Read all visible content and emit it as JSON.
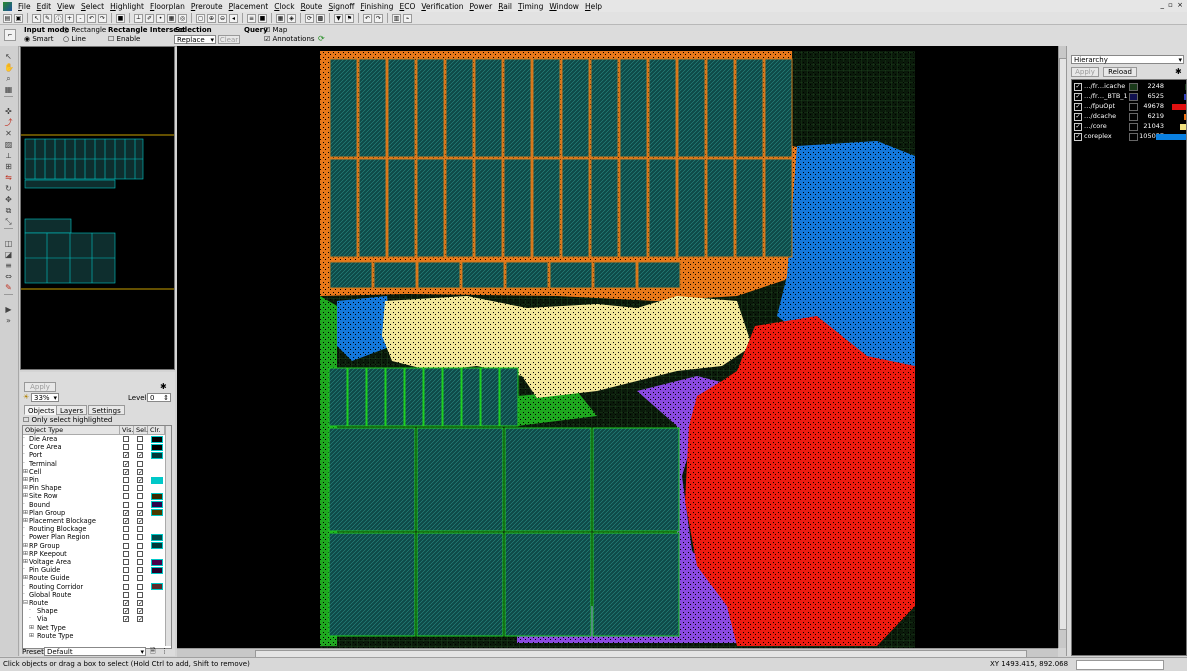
{
  "menubar": {
    "items": [
      "File",
      "Edit",
      "View",
      "Select",
      "Highlight",
      "Floorplan",
      "Preroute",
      "Placement",
      "Clock",
      "Route",
      "Signoff",
      "Finishing",
      "ECO",
      "Verification",
      "Power",
      "Rail",
      "Timing",
      "Window",
      "Help"
    ],
    "window_controls": "_ ▫ ×"
  },
  "options": {
    "input_mode_label": "Input mode",
    "rectangle_label": "Rectangle",
    "smart_label": "Smart",
    "line_label": "Line",
    "rect_intersect_label": "Rectangle Intersect",
    "enable_label": "Enable",
    "selection_label": "Selection",
    "selection_value": "Replace",
    "clear_label": "Clear",
    "query_label": "Query",
    "map_label": "Map",
    "annotations_label": "Annotations"
  },
  "left_panel": {
    "apply_label": "Apply",
    "zoom_value": "33%",
    "level_label": "Level",
    "level_value": "0",
    "tabs": [
      "Objects",
      "Layers",
      "Settings"
    ],
    "only_highlighted_label": "Only select highlighted",
    "columns": [
      "Object Type",
      "Vis.",
      "Sel.",
      "Clr."
    ],
    "rows": [
      {
        "name": "Die Area",
        "vis": false,
        "sel": false,
        "swatch": "#000000",
        "expander": ""
      },
      {
        "name": "Core Area",
        "vis": false,
        "sel": false,
        "swatch": "#000000",
        "expander": ""
      },
      {
        "name": "Port",
        "vis": true,
        "sel": true,
        "swatch": "#003a3a",
        "expander": ""
      },
      {
        "name": "Terminal",
        "vis": true,
        "sel": false,
        "swatch": "",
        "expander": ""
      },
      {
        "name": "Cell",
        "vis": true,
        "sel": true,
        "swatch": "",
        "expander": "+"
      },
      {
        "name": "Pin",
        "vis": false,
        "sel": true,
        "swatch": "#00c8c8",
        "expander": "+"
      },
      {
        "name": "Pin Shape",
        "vis": false,
        "sel": false,
        "swatch": "",
        "expander": "+"
      },
      {
        "name": "Site Row",
        "vis": false,
        "sel": false,
        "swatch": "#3a2a00",
        "expander": "+"
      },
      {
        "name": "Bound",
        "vis": false,
        "sel": false,
        "swatch": "#2a004a",
        "expander": ""
      },
      {
        "name": "Plan Group",
        "vis": true,
        "sel": true,
        "swatch": "#4a3a00",
        "expander": "+"
      },
      {
        "name": "Placement Blockage",
        "vis": true,
        "sel": true,
        "swatch": "",
        "expander": "+"
      },
      {
        "name": "Routing Blockage",
        "vis": false,
        "sel": false,
        "swatch": "",
        "expander": ""
      },
      {
        "name": "Power Plan Region",
        "vis": false,
        "sel": false,
        "swatch": "#004a4a",
        "expander": ""
      },
      {
        "name": "RP Group",
        "vis": false,
        "sel": false,
        "swatch": "#003a3a",
        "expander": "+"
      },
      {
        "name": "RP Keepout",
        "vis": false,
        "sel": false,
        "swatch": "",
        "expander": "+"
      },
      {
        "name": "Voltage Area",
        "vis": false,
        "sel": false,
        "swatch": "#4a004a",
        "expander": "+"
      },
      {
        "name": "Pin Guide",
        "vis": false,
        "sel": false,
        "swatch": "#2a002a",
        "expander": ""
      },
      {
        "name": "Route Guide",
        "vis": false,
        "sel": false,
        "swatch": "",
        "expander": "+"
      },
      {
        "name": "Routing Corridor",
        "vis": false,
        "sel": false,
        "swatch": "#5a2a2a",
        "expander": ""
      },
      {
        "name": "Global Route",
        "vis": false,
        "sel": false,
        "swatch": "",
        "expander": ""
      },
      {
        "name": "Route",
        "vis": true,
        "sel": true,
        "swatch": "",
        "expander": "-"
      },
      {
        "name": "Shape",
        "vis": true,
        "sel": true,
        "swatch": "",
        "expander": "",
        "indent": true
      },
      {
        "name": "Via",
        "vis": true,
        "sel": true,
        "swatch": "",
        "expander": "",
        "indent": true
      },
      {
        "name": "Net Type",
        "vis": null,
        "sel": null,
        "swatch": "",
        "expander": "+",
        "indent": true
      },
      {
        "name": "Route Type",
        "vis": null,
        "sel": null,
        "swatch": "",
        "expander": "+",
        "indent": true
      }
    ],
    "preset_label": "Preset",
    "preset_value": "Default"
  },
  "right_panel": {
    "view_value": "Hierarchy",
    "apply_label": "Apply",
    "reload_label": "Reload",
    "items": [
      {
        "name": "…/fr…icache",
        "count": "2248",
        "color": "#1a3a1a",
        "bar_color": "#1a3a1a",
        "bar_frac": 0.02
      },
      {
        "name": "…/fr…_BTB_1",
        "count": "6525",
        "color": "#101050",
        "bar_color": "#3040c0",
        "bar_frac": 0.06
      },
      {
        "name": "…/fpuOpt",
        "count": "49678",
        "color": "#000000",
        "bar_color": "#e01010",
        "bar_frac": 0.47
      },
      {
        "name": "…/dcache",
        "count": "6219",
        "color": "#000000",
        "bar_color": "#f07010",
        "bar_frac": 0.06
      },
      {
        "name": "…/core",
        "count": "21043",
        "color": "#000000",
        "bar_color": "#f0e080",
        "bar_frac": 0.2
      },
      {
        "name": "coreplex",
        "count": "105057",
        "color": "#000000",
        "bar_color": "#0a80e0",
        "bar_frac": 1.0
      }
    ]
  },
  "status": {
    "message": "Click objects or drag a box to select (Hold Ctrl to add, Shift to remove)",
    "coords": "XY 1493.415, 892.068"
  },
  "colors": {
    "macro_fill": "#0e4a48",
    "macro_border": "#c8781e",
    "region_orange": "#e8781a",
    "region_yellow": "#f2e79a",
    "region_red": "#ee1b10",
    "region_blue": "#1478dc",
    "region_purple": "#8a4ae0",
    "region_green": "#1fa81f",
    "grid": "#2a5a2a"
  }
}
